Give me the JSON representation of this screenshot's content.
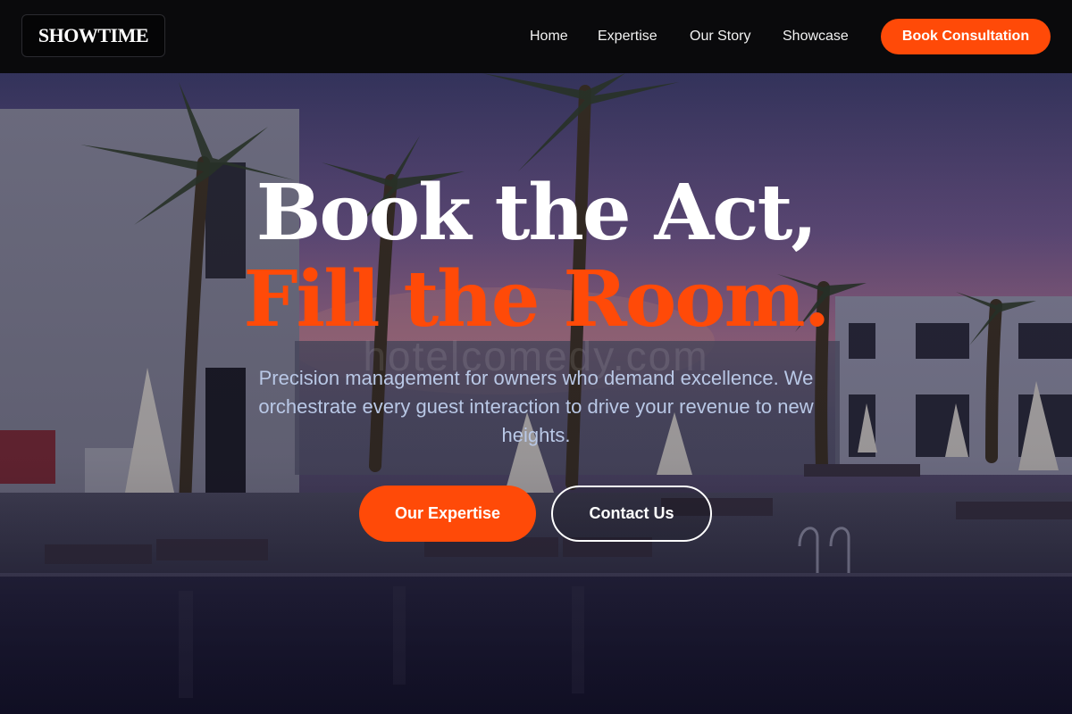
{
  "brand": {
    "logo_text": "SHOWTIME"
  },
  "nav": {
    "links": [
      {
        "label": "Home"
      },
      {
        "label": "Expertise"
      },
      {
        "label": "Our Story"
      },
      {
        "label": "Showcase"
      }
    ],
    "cta_label": "Book Consultation"
  },
  "hero": {
    "headline_line1": "Book the Act,",
    "headline_line2": "Fill the Room.",
    "watermark": "hotelcomedy.com",
    "subtitle": "Precision management for owners who demand excellence. We orchestrate every guest interaction to drive your revenue to new heights.",
    "primary_button": "Our Expertise",
    "secondary_button": "Contact Us"
  },
  "colors": {
    "accent": "#ff4a08",
    "nav_background": "#0a0a0c",
    "subtitle_text": "#b9c8e6"
  }
}
